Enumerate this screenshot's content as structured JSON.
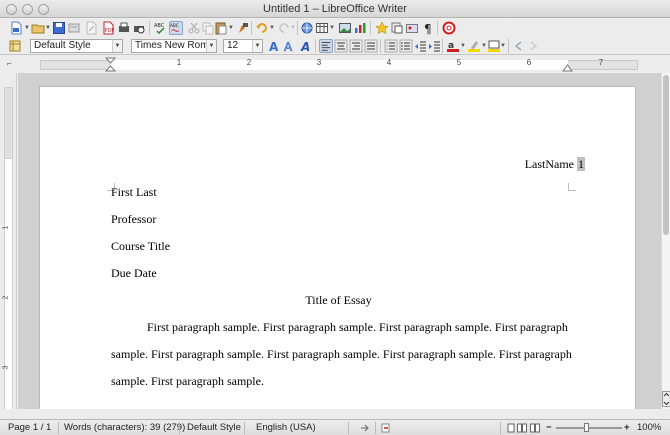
{
  "window": {
    "title": "Untitled 1 – LibreOffice Writer"
  },
  "formatting": {
    "paragraph_style": "Default Style",
    "font_name": "Times New Roma",
    "font_size": "12"
  },
  "ruler": {
    "h_numbers": [
      "1",
      "2",
      "3",
      "4",
      "5",
      "6",
      "7"
    ],
    "v_numbers": [
      "1",
      "2",
      "3"
    ]
  },
  "document": {
    "header_text": "LastName",
    "page_field": "1",
    "lines": [
      "First Last",
      "Professor",
      "Course Title",
      "Due Date"
    ],
    "essay_title": "Title of Essay",
    "paragraph_lines": [
      "First paragraph sample. First paragraph sample. First paragraph sample. First paragraph",
      "sample. First paragraph sample. First paragraph sample. First paragraph sample. First paragraph",
      "sample. First paragraph sample."
    ]
  },
  "status": {
    "page": "Page 1 / 1",
    "words": "Words (characters): 39 (279)",
    "style": "Default Style",
    "language": "English (USA)",
    "zoom": "100%"
  },
  "colors": {
    "field_shade": "#c0c0c0",
    "accent_blue": "#3d6ccf",
    "highlight_yellow": "#f5d800",
    "font_red": "#d02020"
  },
  "icons": [
    "new-document-icon",
    "open-icon",
    "save-icon",
    "export-icon",
    "edit-icon",
    "export-pdf-icon",
    "print-icon",
    "print-preview-icon",
    "spellcheck-icon",
    "autospell-icon",
    "cut-icon",
    "copy-icon",
    "paste-icon",
    "clone-format-icon",
    "undo-icon",
    "redo-icon",
    "hyperlink-icon",
    "table-icon",
    "image-icon",
    "chart-icon",
    "draw-icon",
    "navigator-icon",
    "gallery-icon",
    "formatting-marks-icon",
    "help-icon",
    "styles-icon",
    "font-color-icon",
    "highlight-icon",
    "background-color-icon"
  ]
}
